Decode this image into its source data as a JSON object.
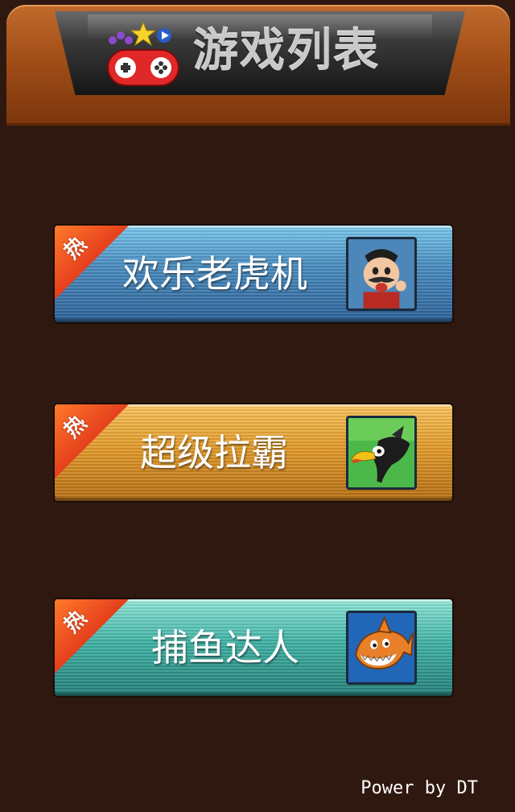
{
  "header": {
    "title": "游戏列表",
    "icon": "gamepad-icon"
  },
  "games": [
    {
      "badge": "热",
      "title": "欢乐老虎机",
      "icon": "fruit-man-icon",
      "color": "#4a8ec0"
    },
    {
      "badge": "热",
      "title": "超级拉霸",
      "icon": "toucan-icon",
      "color": "#e29a2a"
    },
    {
      "badge": "热",
      "title": "捕鱼达人",
      "icon": "shark-icon",
      "color": "#3fb1a4"
    }
  ],
  "footer": {
    "text": "Power by DT"
  }
}
